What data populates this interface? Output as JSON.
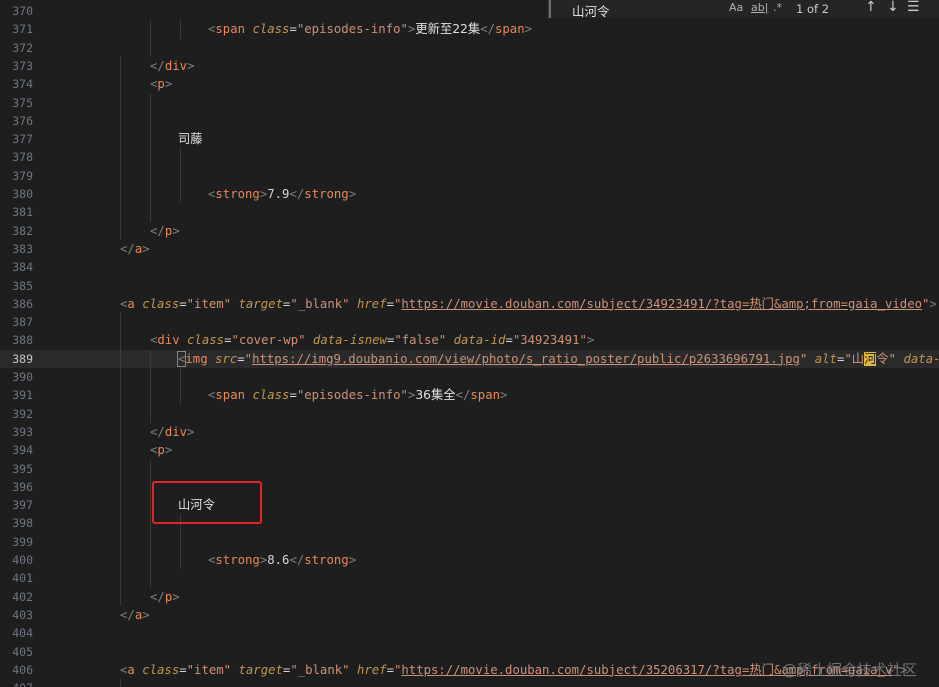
{
  "editor": {
    "lines": [
      {
        "num": "370",
        "guides": [],
        "indent": 0,
        "parts": []
      },
      {
        "num": "371",
        "guides": [
          150,
          180
        ],
        "indent": 208,
        "parts": [
          [
            "br",
            "<"
          ],
          [
            "tag",
            "span"
          ],
          [
            "sp",
            " "
          ],
          [
            "attr",
            "class"
          ],
          [
            "eq",
            "="
          ],
          [
            "str",
            "\"episodes-info\""
          ],
          [
            "br",
            ">"
          ],
          [
            "text",
            "更新至22集"
          ],
          [
            "br",
            "</"
          ],
          [
            "tag",
            "span"
          ],
          [
            "br",
            ">"
          ]
        ]
      },
      {
        "num": "372",
        "guides": [
          150
        ],
        "indent": 0,
        "parts": []
      },
      {
        "num": "373",
        "guides": [
          120
        ],
        "indent": 150,
        "parts": [
          [
            "br",
            "</"
          ],
          [
            "tag",
            "div"
          ],
          [
            "br",
            ">"
          ]
        ]
      },
      {
        "num": "374",
        "guides": [
          120
        ],
        "indent": 150,
        "parts": [
          [
            "br",
            "<"
          ],
          [
            "tag",
            "p"
          ],
          [
            "br",
            ">"
          ]
        ]
      },
      {
        "num": "375",
        "guides": [
          120,
          150
        ],
        "indent": 0,
        "parts": []
      },
      {
        "num": "376",
        "guides": [
          120,
          150
        ],
        "indent": 0,
        "parts": []
      },
      {
        "num": "377",
        "guides": [
          120,
          150
        ],
        "indent": 178,
        "parts": [
          [
            "text",
            "司藤"
          ]
        ]
      },
      {
        "num": "378",
        "guides": [
          120,
          150,
          180
        ],
        "indent": 0,
        "parts": []
      },
      {
        "num": "379",
        "guides": [
          120,
          150,
          180
        ],
        "indent": 0,
        "parts": []
      },
      {
        "num": "380",
        "guides": [
          120,
          150,
          180
        ],
        "indent": 208,
        "parts": [
          [
            "br",
            "<"
          ],
          [
            "tag",
            "strong"
          ],
          [
            "br",
            ">"
          ],
          [
            "code",
            "7.9"
          ],
          [
            "br",
            "</"
          ],
          [
            "tag",
            "strong"
          ],
          [
            "br",
            ">"
          ]
        ]
      },
      {
        "num": "381",
        "guides": [
          120,
          150
        ],
        "indent": 0,
        "parts": []
      },
      {
        "num": "382",
        "guides": [
          120
        ],
        "indent": 150,
        "parts": [
          [
            "br",
            "</"
          ],
          [
            "tag",
            "p"
          ],
          [
            "br",
            ">"
          ]
        ]
      },
      {
        "num": "383",
        "guides": [],
        "indent": 120,
        "parts": [
          [
            "br",
            "</"
          ],
          [
            "tag",
            "a"
          ],
          [
            "br",
            ">"
          ]
        ]
      },
      {
        "num": "384",
        "guides": [],
        "indent": 0,
        "parts": []
      },
      {
        "num": "385",
        "guides": [],
        "indent": 0,
        "parts": []
      },
      {
        "num": "386",
        "guides": [],
        "indent": 120,
        "parts": [
          [
            "br",
            "<"
          ],
          [
            "tag",
            "a"
          ],
          [
            "sp",
            " "
          ],
          [
            "attr",
            "class"
          ],
          [
            "eq",
            "="
          ],
          [
            "str",
            "\"item\""
          ],
          [
            "sp",
            " "
          ],
          [
            "attr",
            "target"
          ],
          [
            "eq",
            "="
          ],
          [
            "str",
            "\"_blank\""
          ],
          [
            "sp",
            " "
          ],
          [
            "attr",
            "href"
          ],
          [
            "eq",
            "="
          ],
          [
            "str",
            "\""
          ],
          [
            "link",
            "https://movie.douban.com/subject/34923491/?tag=热门&amp;from=gaia_video"
          ],
          [
            "str",
            "\""
          ],
          [
            "br",
            ">"
          ]
        ]
      },
      {
        "num": "387",
        "guides": [
          120
        ],
        "indent": 0,
        "parts": []
      },
      {
        "num": "388",
        "guides": [
          120
        ],
        "indent": 150,
        "parts": [
          [
            "br",
            "<"
          ],
          [
            "tag",
            "div"
          ],
          [
            "sp",
            " "
          ],
          [
            "attr",
            "class"
          ],
          [
            "eq",
            "="
          ],
          [
            "str",
            "\"cover-wp\""
          ],
          [
            "sp",
            " "
          ],
          [
            "attr",
            "data-isnew"
          ],
          [
            "eq",
            "="
          ],
          [
            "str",
            "\"false\""
          ],
          [
            "sp",
            " "
          ],
          [
            "attr",
            "data-id"
          ],
          [
            "eq",
            "="
          ],
          [
            "str",
            "\"34923491\""
          ],
          [
            "br",
            ">"
          ]
        ]
      },
      {
        "num": "389",
        "guides": [
          120,
          150
        ],
        "indent": 178,
        "current": true,
        "parts": [
          [
            "brhl",
            "<"
          ],
          [
            "tag",
            "img"
          ],
          [
            "sp",
            " "
          ],
          [
            "attr",
            "src"
          ],
          [
            "eq",
            "="
          ],
          [
            "str",
            "\""
          ],
          [
            "link",
            "https://img9.doubanio.com/view/photo/s_ratio_poster/public/p2633696791.jpg"
          ],
          [
            "str",
            "\""
          ],
          [
            "sp",
            " "
          ],
          [
            "attr",
            "alt"
          ],
          [
            "eq",
            "="
          ],
          [
            "str",
            "\"山"
          ],
          [
            "match",
            "河"
          ],
          [
            "str",
            "令\""
          ],
          [
            "sp",
            " "
          ],
          [
            "attr",
            "data-"
          ]
        ]
      },
      {
        "num": "390",
        "guides": [
          120,
          150,
          180
        ],
        "indent": 0,
        "parts": []
      },
      {
        "num": "391",
        "guides": [
          120,
          150,
          180
        ],
        "indent": 208,
        "parts": [
          [
            "br",
            "<"
          ],
          [
            "tag",
            "span"
          ],
          [
            "sp",
            " "
          ],
          [
            "attr",
            "class"
          ],
          [
            "eq",
            "="
          ],
          [
            "str",
            "\"episodes-info\""
          ],
          [
            "br",
            ">"
          ],
          [
            "text",
            "36集全"
          ],
          [
            "br",
            "</"
          ],
          [
            "tag",
            "span"
          ],
          [
            "br",
            ">"
          ]
        ]
      },
      {
        "num": "392",
        "guides": [
          120,
          150
        ],
        "indent": 0,
        "parts": []
      },
      {
        "num": "393",
        "guides": [
          120
        ],
        "indent": 150,
        "parts": [
          [
            "br",
            "</"
          ],
          [
            "tag",
            "div"
          ],
          [
            "br",
            ">"
          ]
        ]
      },
      {
        "num": "394",
        "guides": [
          120
        ],
        "indent": 150,
        "parts": [
          [
            "br",
            "<"
          ],
          [
            "tag",
            "p"
          ],
          [
            "br",
            ">"
          ]
        ]
      },
      {
        "num": "395",
        "guides": [
          120,
          150
        ],
        "indent": 0,
        "parts": []
      },
      {
        "num": "396",
        "guides": [
          120,
          150
        ],
        "indent": 0,
        "parts": []
      },
      {
        "num": "397",
        "guides": [
          120,
          150
        ],
        "indent": 178,
        "parts": [
          [
            "text",
            "山河令"
          ]
        ]
      },
      {
        "num": "398",
        "guides": [
          120,
          150,
          180
        ],
        "indent": 0,
        "parts": []
      },
      {
        "num": "399",
        "guides": [
          120,
          150,
          180
        ],
        "indent": 0,
        "parts": []
      },
      {
        "num": "400",
        "guides": [
          120,
          150,
          180
        ],
        "indent": 208,
        "parts": [
          [
            "br",
            "<"
          ],
          [
            "tag",
            "strong"
          ],
          [
            "br",
            ">"
          ],
          [
            "code",
            "8.6"
          ],
          [
            "br",
            "</"
          ],
          [
            "tag",
            "strong"
          ],
          [
            "br",
            ">"
          ]
        ]
      },
      {
        "num": "401",
        "guides": [
          120,
          150
        ],
        "indent": 0,
        "parts": []
      },
      {
        "num": "402",
        "guides": [
          120
        ],
        "indent": 150,
        "parts": [
          [
            "br",
            "</"
          ],
          [
            "tag",
            "p"
          ],
          [
            "br",
            ">"
          ]
        ]
      },
      {
        "num": "403",
        "guides": [],
        "indent": 120,
        "parts": [
          [
            "br",
            "</"
          ],
          [
            "tag",
            "a"
          ],
          [
            "br",
            ">"
          ]
        ]
      },
      {
        "num": "404",
        "guides": [],
        "indent": 0,
        "parts": []
      },
      {
        "num": "405",
        "guides": [],
        "indent": 0,
        "parts": []
      },
      {
        "num": "406",
        "guides": [],
        "indent": 120,
        "parts": [
          [
            "br",
            "<"
          ],
          [
            "tag",
            "a"
          ],
          [
            "sp",
            " "
          ],
          [
            "attr",
            "class"
          ],
          [
            "eq",
            "="
          ],
          [
            "str",
            "\"item\""
          ],
          [
            "sp",
            " "
          ],
          [
            "attr",
            "target"
          ],
          [
            "eq",
            "="
          ],
          [
            "str",
            "\"_blank\""
          ],
          [
            "sp",
            " "
          ],
          [
            "attr",
            "href"
          ],
          [
            "eq",
            "="
          ],
          [
            "str",
            "\""
          ],
          [
            "link",
            "https://movie.douban.com/subject/35206317/?tag=热门&amp;from=gaia_v"
          ],
          [
            "str",
            "\""
          ],
          [
            "br",
            ">"
          ]
        ]
      },
      {
        "num": "407",
        "guides": [
          120
        ],
        "indent": 0,
        "parts": []
      }
    ]
  },
  "find_widget": {
    "query": "山河令",
    "match_case_label": "Aa",
    "whole_word_label": "ab|",
    "regex_label": ".*",
    "result_count": "1 of 2",
    "prev_icon": "arrow-up-icon",
    "next_icon": "arrow-down-icon",
    "selection_icon": "find-in-selection-icon"
  },
  "watermark": "@稀土掘金技术社区",
  "colors": {
    "background": "#1e1e1e",
    "tag": "#e8875b",
    "attribute": "#c09553",
    "string": "#ce9178",
    "match_highlight": "#e2b93d",
    "annotation_box": "#e02525"
  }
}
